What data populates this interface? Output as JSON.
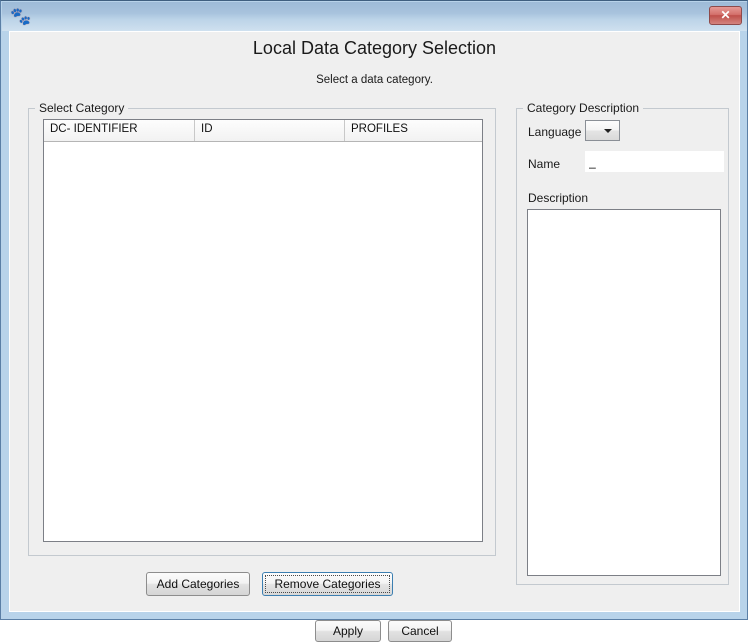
{
  "window": {
    "icon": "app-logo-icon",
    "close_label": "✕",
    "titlebar_gradient_top": "#9ebbd8",
    "titlebar_gradient_bottom": "#cfe0ef",
    "frame_color": "#b8d3ea"
  },
  "dialog": {
    "title": "Local Data Category Selection",
    "subtitle": "Select a data category."
  },
  "select_category": {
    "group_label": "Select Category",
    "table": {
      "columns": [
        "DC- IDENTIFIER",
        "ID",
        "PROFILES"
      ],
      "rows": []
    },
    "buttons": {
      "add": "Add Categories",
      "remove": "Remove Categories"
    }
  },
  "category_description": {
    "group_label": "Category Description",
    "language": {
      "label": "Language",
      "value": "",
      "options": [],
      "arrow_icon": "chevron-down-icon"
    },
    "name": {
      "label": "Name",
      "value": "_",
      "placeholder": ""
    },
    "description": {
      "label": "Description",
      "value": "",
      "placeholder": ""
    }
  },
  "footer": {
    "apply": "Apply",
    "cancel": "Cancel"
  },
  "colors": {
    "accent": "#3c7fb1",
    "close_button": "#bf4f4a",
    "icon_red": "#e02020",
    "dialog_bg": "#efefef"
  }
}
